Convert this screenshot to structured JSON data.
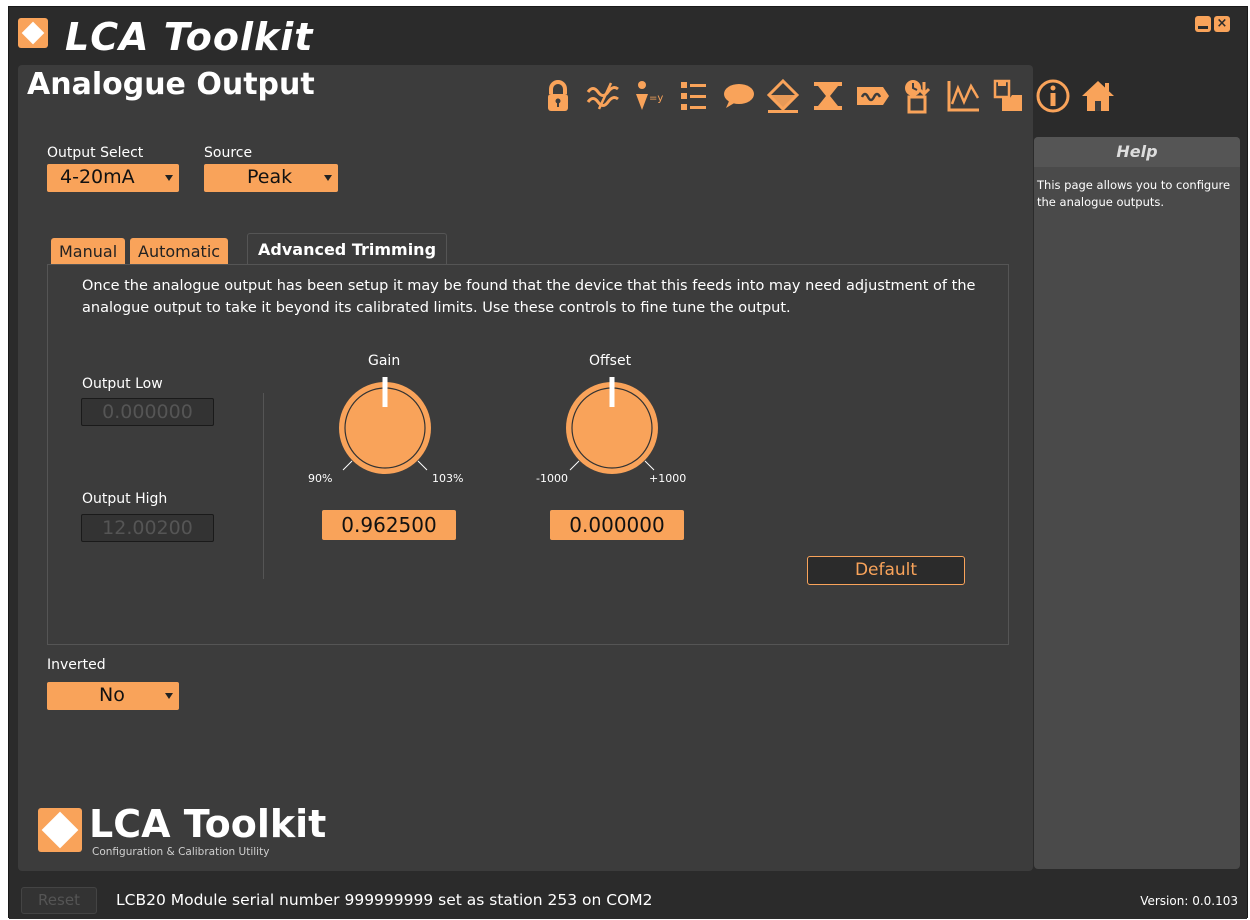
{
  "window": {
    "title": "LCA Toolkit",
    "close_glyph": "×"
  },
  "page": {
    "title": "Analogue Output"
  },
  "toolbar": {
    "icons": [
      "lock-icon",
      "filter-wave-icon",
      "linearise-icon",
      "settings-list-icon",
      "comment-icon",
      "tare-icon",
      "range-icon",
      "signal-icon",
      "download-icon",
      "chart-icon",
      "save-open-icon",
      "info-icon",
      "home-icon"
    ]
  },
  "output_select": {
    "label": "Output Select",
    "value": "4-20mA"
  },
  "source": {
    "label": "Source",
    "value": "Peak"
  },
  "tabs": [
    {
      "label": "Manual",
      "active": false
    },
    {
      "label": "Automatic",
      "active": false
    },
    {
      "label": "Advanced Trimming",
      "active": true
    }
  ],
  "trimming": {
    "description": "Once the analogue output has been setup it may be found that the device that this feeds into may need adjustment of the analogue output to take it beyond its calibrated limits. Use these controls to fine tune the output.",
    "output_low": {
      "label": "Output Low",
      "value": "0.000000"
    },
    "output_high": {
      "label": "Output High",
      "value": "12.00200"
    },
    "gain": {
      "label": "Gain",
      "min_label": "90%",
      "max_label": "103%",
      "value": "0.962500",
      "level": 0.5
    },
    "offset": {
      "label": "Offset",
      "min_label": "-1000",
      "max_label": "+1000",
      "value": "0.000000",
      "level": 0.5
    },
    "default_button": "Default"
  },
  "inverted": {
    "label": "Inverted",
    "value": "No"
  },
  "footer_logo": {
    "name": "LCA Toolkit",
    "tagline": "Configuration & Calibration Utility"
  },
  "help": {
    "title": "Help",
    "text": "This page allows you to configure the analogue outputs."
  },
  "status": {
    "reset_label": "Reset",
    "message": "LCB20 Module serial number 999999999 set as station 253 on COM2",
    "version": "Version: 0.0.103"
  },
  "colors": {
    "accent": "#f9a35a",
    "background": "#2b2b2b",
    "panel": "#3c3c3c"
  }
}
